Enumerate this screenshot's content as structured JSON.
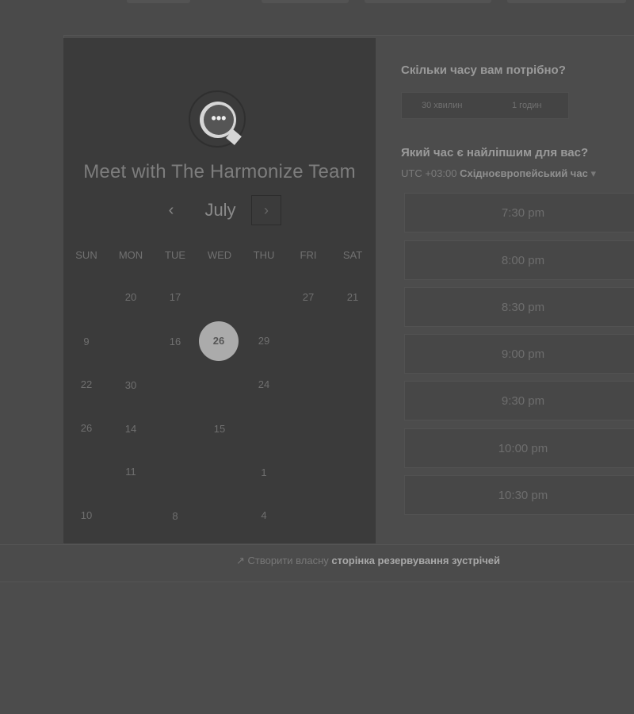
{
  "meeting": {
    "title": "Meet with The Harmonize Team",
    "logo_icon": "chat-bubble-icon",
    "logo_glyph": "•••"
  },
  "calendar": {
    "month": "July",
    "prev_glyph": "‹",
    "next_glyph": "›",
    "weekdays": [
      "SUN",
      "MON",
      "TUE",
      "WED",
      "THU",
      "FRI",
      "SAT"
    ],
    "rows": [
      [
        "",
        "20",
        "17",
        "",
        "",
        "27",
        "21"
      ],
      [
        "9",
        "",
        "16",
        "26",
        "29",
        "",
        ""
      ],
      [
        "22",
        "30",
        "",
        "",
        "24",
        "",
        ""
      ],
      [
        "26",
        "14",
        "",
        "15",
        "",
        "",
        ""
      ],
      [
        "",
        "11",
        "",
        "",
        "1",
        "",
        ""
      ],
      [
        "10",
        "",
        "8",
        "",
        "4",
        "",
        ""
      ]
    ],
    "selected_day": "26"
  },
  "duration": {
    "question": "Скільки часу вам потрібно?",
    "options": [
      "30 хвилин",
      "1 годин"
    ]
  },
  "time": {
    "question": "Який час є найліпшим для вас?",
    "tz_prefix": "UTC +03:00",
    "tz_name": "Східноєвропейський час",
    "tz_chevron": "▾",
    "slots": [
      "7:30 pm",
      "8:00 pm",
      "8:30 pm",
      "9:00 pm",
      "9:30 pm",
      "10:00 pm",
      "10:30 pm"
    ]
  },
  "footer": {
    "icon": "link-arrow-icon",
    "prefix": "Створити власну",
    "link": "сторінка резервування зустрічей"
  }
}
